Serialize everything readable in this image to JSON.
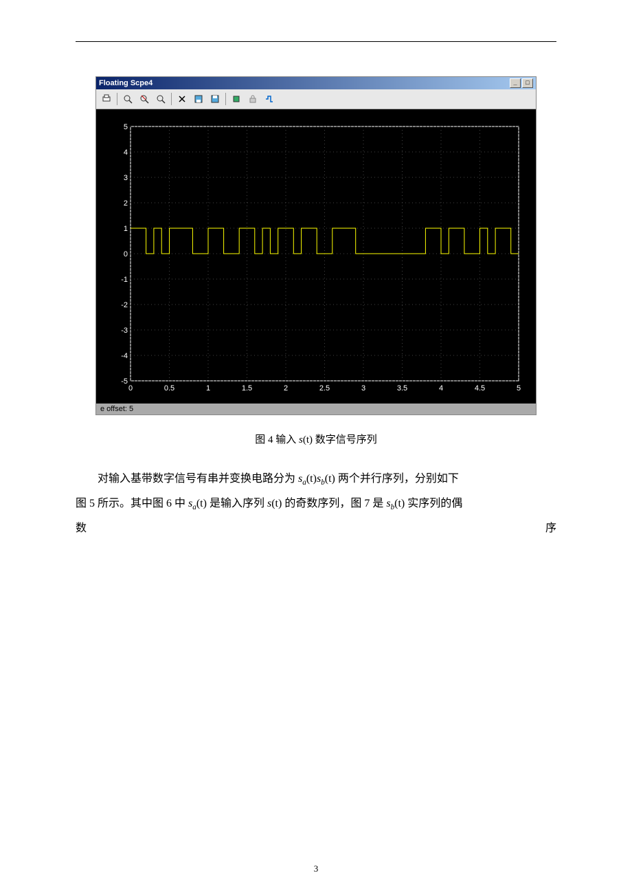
{
  "scope": {
    "title": "Floating Scpe4",
    "winbtn_min": "_",
    "winbtn_max": "□",
    "footer": "e offset:  5"
  },
  "chart_data": {
    "type": "line",
    "title": "",
    "xlabel": "",
    "ylabel": "",
    "xlim": [
      0,
      5
    ],
    "ylim": [
      -5,
      5
    ],
    "xticks": [
      "0",
      "0.5",
      "1",
      "1.5",
      "2",
      "2.5",
      "3",
      "3.5",
      "4",
      "4.5",
      "5"
    ],
    "yticks": [
      "-5",
      "-4",
      "-3",
      "-2",
      "-1",
      "0",
      "1",
      "2",
      "3",
      "4",
      "5"
    ],
    "series": [
      {
        "name": "s(t)",
        "step": true,
        "color": "#ffff00",
        "x_bits": [
          0.0,
          0.1,
          0.2,
          0.3,
          0.4,
          0.5,
          0.6,
          0.7,
          0.8,
          0.9,
          1.0,
          1.1,
          1.2,
          1.3,
          1.4,
          1.5,
          1.6,
          1.7,
          1.8,
          1.9,
          2.0,
          2.1,
          2.2,
          2.3,
          2.4,
          2.5,
          2.6,
          2.7,
          2.8,
          2.9,
          3.0,
          3.1,
          3.2,
          3.3,
          3.4,
          3.5,
          3.6,
          3.7,
          3.8,
          3.9,
          4.0,
          4.1,
          4.2,
          4.3,
          4.4,
          4.5,
          4.6,
          4.7,
          4.8,
          4.9
        ],
        "values": [
          1,
          1,
          0,
          1,
          0,
          1,
          1,
          1,
          0,
          0,
          1,
          1,
          0,
          0,
          1,
          1,
          0,
          1,
          0,
          1,
          1,
          0,
          1,
          1,
          0,
          0,
          1,
          1,
          1,
          0,
          0,
          0,
          0,
          0,
          0,
          0,
          0,
          0,
          1,
          1,
          0,
          1,
          1,
          0,
          0,
          1,
          0,
          1,
          1,
          0
        ]
      }
    ]
  },
  "doc": {
    "caption_pre": "图 4 输入",
    "caption_mid": "s(t)",
    "caption_post": "数字信号序列",
    "p1_a": "对输入基带数字信号有串并变换电路分为",
    "p1_b": "两个并行序列，分别如下",
    "p2_a": "图 5 所示。其中图 6 中",
    "p2_b": "是输入序列",
    "p2_c": "的奇数序列，图 7 是",
    "p2_d": "实序列的偶",
    "p3_left": "数",
    "p3_right": "序",
    "sa": "s",
    "sa_sub": "a",
    "sb": "s",
    "sb_sub": "b",
    "s": "s",
    "t": "(t)",
    "page": "3"
  }
}
